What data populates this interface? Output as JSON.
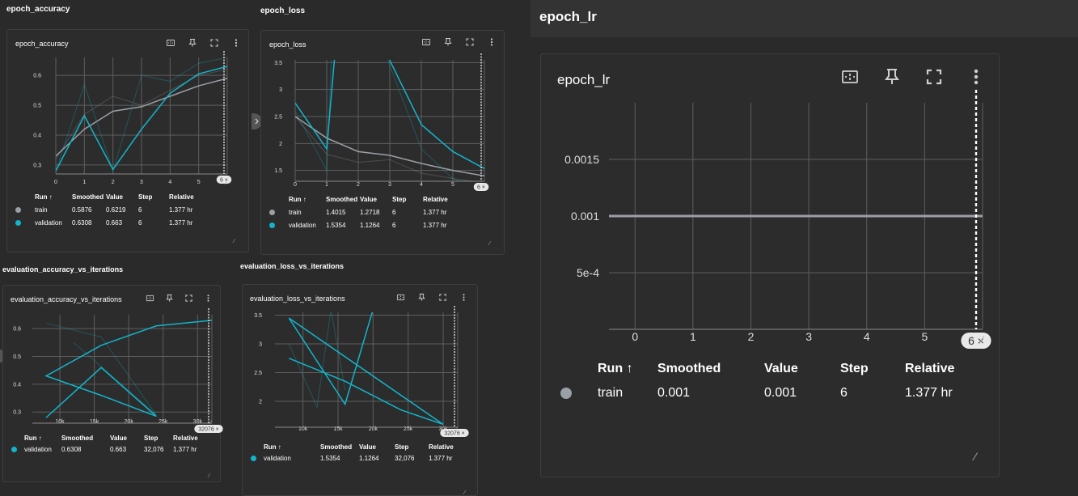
{
  "colors": {
    "train": "#9aa0a6",
    "validation": "#12b5cb",
    "background": "#2a2a2a",
    "card": "#2c2c2c",
    "grid": "#5a5a5a"
  },
  "icons": {
    "fit": "fit-domain-icon",
    "pin": "pin-icon",
    "fullscreen": "fullscreen-icon",
    "menu": "more-vert-icon",
    "resize": "resize-icon",
    "close": "close-icon"
  },
  "sections": {
    "epoch_accuracy": "epoch_accuracy",
    "epoch_loss": "epoch_loss",
    "epoch_lr": "epoch_lr",
    "eval_acc": "evaluation_accuracy_vs_iterations",
    "eval_loss": "evaluation_loss_vs_iterations"
  },
  "table_headers": {
    "run": "Run ↑",
    "smoothed": "Smoothed",
    "value": "Value",
    "step": "Step",
    "relative": "Relative"
  },
  "cards": {
    "epoch_accuracy": {
      "title": "epoch_accuracy",
      "step_marker": "6 ×",
      "rows": [
        {
          "run": "train",
          "smoothed": "0.5876",
          "value": "0.6219",
          "step": "6",
          "relative": "1.377 hr"
        },
        {
          "run": "validation",
          "smoothed": "0.6308",
          "value": "0.663",
          "step": "6",
          "relative": "1.377 hr"
        }
      ]
    },
    "epoch_loss": {
      "title": "epoch_loss",
      "step_marker": "6 ×",
      "rows": [
        {
          "run": "train",
          "smoothed": "1.4015",
          "value": "1.2718",
          "step": "6",
          "relative": "1.377 hr"
        },
        {
          "run": "validation",
          "smoothed": "1.5354",
          "value": "1.1264",
          "step": "6",
          "relative": "1.377 hr"
        }
      ]
    },
    "epoch_lr": {
      "title": "epoch_lr",
      "step_marker": "6 ×",
      "rows": [
        {
          "run": "train",
          "smoothed": "0.001",
          "value": "0.001",
          "step": "6",
          "relative": "1.377 hr"
        }
      ]
    },
    "eval_acc": {
      "title": "evaluation_accuracy_vs_iterations",
      "step_marker": "32076 ×",
      "rows": [
        {
          "run": "validation",
          "smoothed": "0.6308",
          "value": "0.663",
          "step": "32,076",
          "relative": "1.377 hr"
        }
      ]
    },
    "eval_loss": {
      "title": "evaluation_loss_vs_iterations",
      "step_marker": "32076 ×",
      "rows": [
        {
          "run": "validation",
          "smoothed": "1.5354",
          "value": "1.1264",
          "step": "32,076",
          "relative": "1.377 hr"
        }
      ]
    }
  },
  "chart_data": [
    {
      "id": "epoch_accuracy",
      "type": "line",
      "x_ticks": [
        "0",
        "1",
        "2",
        "3",
        "4",
        "5"
      ],
      "y_ticks": [
        "0.3",
        "0.4",
        "0.5",
        "0.6"
      ],
      "xlim": [
        0,
        6
      ],
      "ylim": [
        0.27,
        0.66
      ],
      "grid": true,
      "series": [
        {
          "name": "train",
          "color": "#9aa0a6",
          "smoothed": [
            [
              0,
              0.33
            ],
            [
              1,
              0.42
            ],
            [
              2,
              0.48
            ],
            [
              3,
              0.495
            ],
            [
              4,
              0.53
            ],
            [
              5,
              0.565
            ],
            [
              6,
              0.59
            ]
          ],
          "raw": [
            [
              0,
              0.32
            ],
            [
              1,
              0.47
            ],
            [
              2,
              0.53
            ],
            [
              3,
              0.5
            ],
            [
              4,
              0.55
            ],
            [
              5,
              0.6
            ],
            [
              6,
              0.62
            ]
          ]
        },
        {
          "name": "validation",
          "color": "#12b5cb",
          "smoothed": [
            [
              0,
              0.28
            ],
            [
              1,
              0.465
            ],
            [
              2,
              0.285
            ],
            [
              3,
              0.42
            ],
            [
              4,
              0.54
            ],
            [
              5,
              0.605
            ],
            [
              6,
              0.63
            ]
          ],
          "raw": [
            [
              0,
              0.28
            ],
            [
              1,
              0.57
            ],
            [
              2,
              0.28
            ],
            [
              3,
              0.6
            ],
            [
              4,
              0.58
            ],
            [
              5,
              0.64
            ],
            [
              6,
              0.66
            ]
          ]
        }
      ]
    },
    {
      "id": "epoch_loss",
      "type": "line",
      "x_ticks": [
        "0",
        "1",
        "2",
        "3",
        "4",
        "5"
      ],
      "y_ticks": [
        "1.5",
        "2",
        "2.5",
        "3",
        "3.5"
      ],
      "xlim": [
        0,
        6
      ],
      "ylim": [
        1.3,
        3.55
      ],
      "grid": true,
      "series": [
        {
          "name": "train",
          "color": "#9aa0a6",
          "smoothed": [
            [
              0,
              2.5
            ],
            [
              1,
              2.1
            ],
            [
              2,
              1.85
            ],
            [
              3,
              1.78
            ],
            [
              4,
              1.63
            ],
            [
              5,
              1.5
            ],
            [
              6,
              1.4
            ]
          ],
          "raw": [
            [
              0,
              2.5
            ],
            [
              1,
              1.8
            ],
            [
              2,
              1.65
            ],
            [
              3,
              1.7
            ],
            [
              4,
              1.45
            ],
            [
              5,
              1.35
            ],
            [
              6,
              1.27
            ]
          ]
        },
        {
          "name": "validation",
          "color": "#12b5cb",
          "smoothed": [
            [
              0,
              2.75
            ],
            [
              1,
              1.9
            ],
            [
              1.25,
              3.6
            ],
            [
              2.95,
              3.6
            ],
            [
              4,
              2.35
            ],
            [
              5,
              1.85
            ],
            [
              6,
              1.535
            ]
          ],
          "raw": [
            [
              0,
              2.6
            ],
            [
              1,
              1.5
            ],
            [
              1.15,
              3.6
            ],
            [
              2.9,
              3.6
            ],
            [
              4,
              1.9
            ],
            [
              5,
              1.35
            ],
            [
              6,
              1.13
            ]
          ]
        }
      ]
    },
    {
      "id": "epoch_lr",
      "type": "line",
      "x_ticks": [
        "0",
        "1",
        "2",
        "3",
        "4",
        "5"
      ],
      "y_ticks": [
        "5e-4",
        "0.001",
        "0.0015"
      ],
      "xlim": [
        -0.45,
        6
      ],
      "ylim": [
        0,
        0.002
      ],
      "grid": true,
      "series": [
        {
          "name": "train",
          "color": "#9aa0a6",
          "smoothed": [
            [
              -0.45,
              0.001
            ],
            [
              6,
              0.001
            ]
          ],
          "raw": []
        }
      ]
    },
    {
      "id": "eval_acc",
      "type": "line",
      "x_ticks": [
        "10k",
        "15k",
        "20k",
        "25k",
        "30k"
      ],
      "y_ticks": [
        "0.3",
        "0.4",
        "0.5",
        "0.6"
      ],
      "xlim": [
        6000,
        32076
      ],
      "ylim": [
        0.26,
        0.65
      ],
      "grid": true,
      "series": [
        {
          "name": "validation",
          "color": "#12b5cb",
          "smoothed": [
            [
              8000,
              0.28
            ],
            [
              16000,
              0.46
            ],
            [
              24000,
              0.285
            ],
            [
              16000,
              0.36
            ],
            [
              8000,
              0.43
            ],
            [
              16000,
              0.54
            ],
            [
              24000,
              0.61
            ],
            [
              32076,
              0.63
            ]
          ],
          "raw": [
            [
              8000,
              0.62
            ],
            [
              16000,
              0.57
            ],
            [
              24000,
              0.29
            ],
            [
              12000,
              0.55
            ]
          ]
        }
      ]
    },
    {
      "id": "eval_loss",
      "type": "line",
      "x_ticks": [
        "10k",
        "15k",
        "20k",
        "25k",
        "30k"
      ],
      "y_ticks": [
        "2",
        "2.5",
        "3",
        "3.5"
      ],
      "xlim": [
        6000,
        32076
      ],
      "ylim": [
        1.55,
        3.55
      ],
      "grid": true,
      "series": [
        {
          "name": "validation",
          "color": "#12b5cb",
          "smoothed": [
            [
              8000,
              2.75
            ],
            [
              16000,
              2.35
            ],
            [
              24000,
              1.85
            ],
            [
              30000,
              1.6
            ],
            [
              8000,
              3.45
            ],
            [
              16000,
              1.95
            ],
            [
              20000,
              3.6
            ]
          ],
          "raw": [
            [
              8000,
              3.0
            ],
            [
              12000,
              1.9
            ],
            [
              14000,
              3.6
            ],
            [
              16000,
              2.2
            ]
          ]
        }
      ]
    }
  ]
}
